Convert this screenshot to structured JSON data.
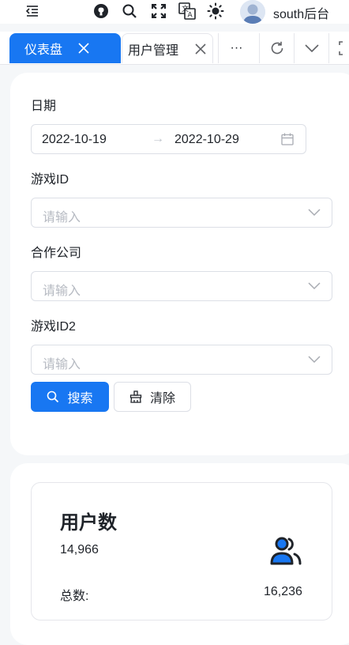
{
  "header": {
    "icons": [
      "menu-fold-icon",
      "github-icon",
      "search-icon",
      "fullscreen-icon",
      "translate-icon",
      "theme-sun-icon"
    ],
    "username": "south后台"
  },
  "tabs": [
    {
      "label": "仪表盘",
      "active": true
    },
    {
      "label": "用户管理",
      "active": false
    }
  ],
  "tab_tools": {
    "more": "···"
  },
  "form": {
    "date": {
      "label": "日期",
      "start": "2022-10-19",
      "separator": "→",
      "end": "2022-10-29"
    },
    "game_id": {
      "label": "游戏ID",
      "placeholder": "请输入"
    },
    "company": {
      "label": "合作公司",
      "placeholder": "请输入"
    },
    "game_id2": {
      "label": "游戏ID2",
      "placeholder": "请输入"
    },
    "search_label": "搜索",
    "clear_label": "清除"
  },
  "stats": {
    "title": "用户数",
    "value": "14,966",
    "total_label": "总数:",
    "total_value": "16,236"
  },
  "colors": {
    "accent": "#1877f2",
    "background": "#f5f7f9",
    "border": "#dcdfe6",
    "placeholder": "#b6bac2"
  }
}
